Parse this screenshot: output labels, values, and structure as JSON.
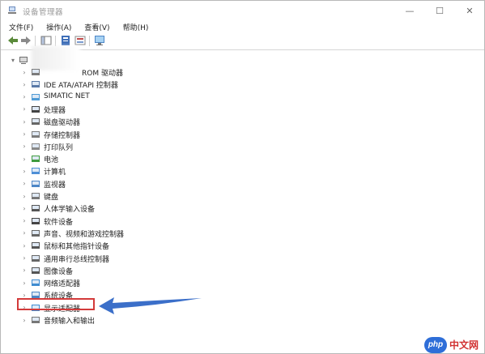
{
  "window": {
    "title": "设备管理器",
    "controls": {
      "minimize": "—",
      "maximize": "☐",
      "close": "✕"
    }
  },
  "menu": [
    "文件(F)",
    "操作(A)",
    "查看(V)",
    "帮助(H)"
  ],
  "tree": {
    "root_label": "",
    "items": [
      "ROM 驱动器",
      "IDE ATA/ATAPI 控制器",
      "SIMATIC NET",
      "处理器",
      "磁盘驱动器",
      "存储控制器",
      "打印队列",
      "电池",
      "计算机",
      "监视器",
      "键盘",
      "人体学输入设备",
      "软件设备",
      "声音、视频和游戏控制器",
      "鼠标和其他指针设备",
      "通用串行总线控制器",
      "图像设备",
      "网络适配器",
      "系统设备",
      "显示适配器",
      "音频输入和输出"
    ]
  },
  "colors": {
    "highlight": "#d33a3a",
    "arrow": "#3b6fc9"
  },
  "watermark": {
    "logo": "php",
    "text": "中文网"
  }
}
